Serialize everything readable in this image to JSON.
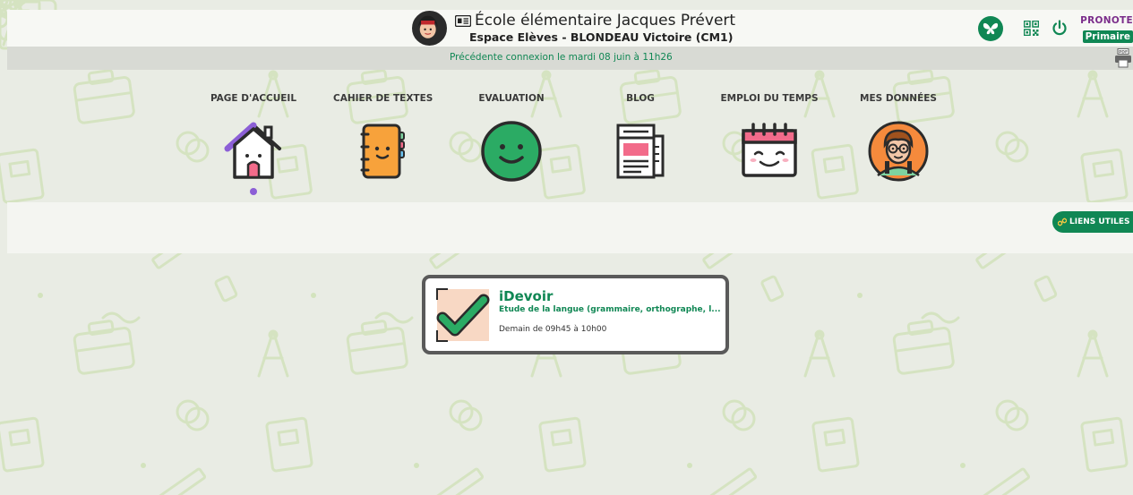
{
  "header": {
    "school_name": "École élémentaire Jacques Prévert",
    "space_label": "Espace Elèves - BLONDEAU Victoire (CM1)",
    "logo_top": "PRONOTE",
    "logo_bottom": "Primaire"
  },
  "connection": {
    "text": "Précédente connexion le mardi 08 juin à 11h26"
  },
  "nav": {
    "items": [
      {
        "label": "PAGE D'ACCUEIL",
        "icon": "house-icon",
        "active": true
      },
      {
        "label": "CAHIER DE TEXTES",
        "icon": "notebook-icon",
        "active": false
      },
      {
        "label": "EVALUATION",
        "icon": "smiley-icon",
        "active": false
      },
      {
        "label": "BLOG",
        "icon": "newspaper-icon",
        "active": false
      },
      {
        "label": "EMPLOI DU TEMPS",
        "icon": "calendar-icon",
        "active": false
      },
      {
        "label": "MES DONNÉES",
        "icon": "student-avatar-icon",
        "active": false
      }
    ]
  },
  "liens_utiles": {
    "label": "LIENS UTILES"
  },
  "card": {
    "title": "iDevoir",
    "subject": "Étude de la langue (grammaire, orthographe, l...",
    "time": "Demain de 09h45 à 10h00"
  },
  "colors": {
    "brand_green": "#108754",
    "pronote_purple": "#7b2d8b",
    "active_dot": "#8c5fd6",
    "background": "#e9ece4"
  }
}
